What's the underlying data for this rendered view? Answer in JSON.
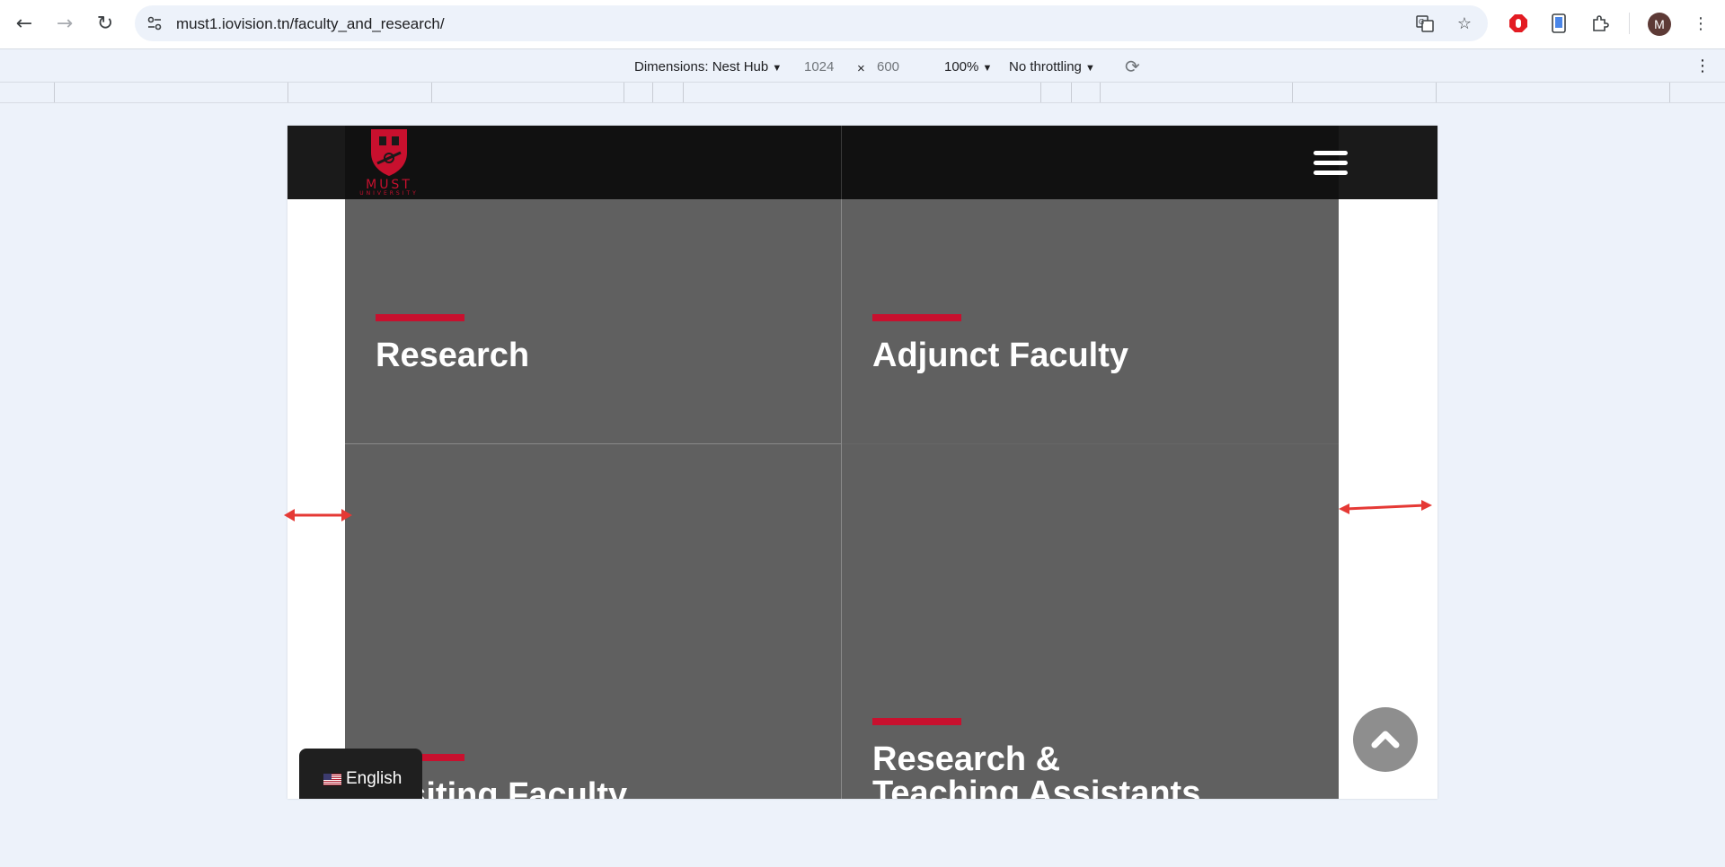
{
  "browser": {
    "url": "must1.iovision.tn/faculty_and_research/",
    "avatar_initial": "M",
    "icons": [
      "back-icon",
      "forward-icon",
      "reload-icon",
      "site-settings-icon",
      "translate-icon",
      "bookmark-star-icon",
      "adblock-icon",
      "tablet-icon",
      "extensions-icon",
      "menu-dots-icon"
    ]
  },
  "devtools": {
    "dimensions_label": "Dimensions: Nest Hub",
    "width": "1024",
    "times": "×",
    "height": "600",
    "zoom": "100%",
    "throttling": "No throttling"
  },
  "site": {
    "logo_text": "MUST",
    "logo_subtext": "UNIVERSITY",
    "tiles": [
      {
        "title": "Research"
      },
      {
        "title": "Adjunct Faculty"
      },
      {
        "title": "Visiting Faculty"
      },
      {
        "title_line1": "Research &",
        "title_line2": "Teaching Assistants"
      }
    ],
    "language": "English"
  },
  "colors": {
    "accent": "#c8102e",
    "header": "#111111",
    "tile": "#606060",
    "annotation_arrow": "#e53935"
  }
}
